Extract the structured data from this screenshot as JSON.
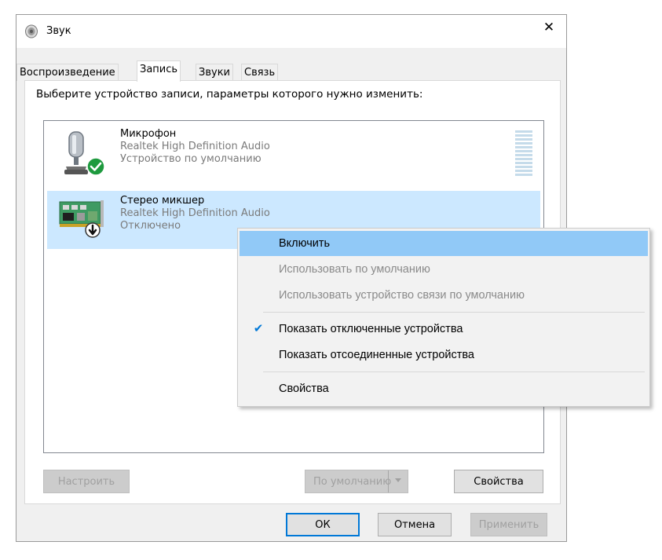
{
  "window": {
    "title": "Звук",
    "close_glyph": "✕"
  },
  "tabs": [
    {
      "label": "Воспроизведение",
      "active": false
    },
    {
      "label": "Запись",
      "active": true
    },
    {
      "label": "Звуки",
      "active": false
    },
    {
      "label": "Связь",
      "active": false
    }
  ],
  "recording": {
    "instruction": "Выберите устройство записи, параметры которого нужно изменить:",
    "devices": [
      {
        "name": "Микрофон",
        "driver": "Realtek High Definition Audio",
        "status": "Устройство по умолчанию",
        "icon": "microphone-icon",
        "badge": "default-check-icon",
        "selected": false
      },
      {
        "name": "Стерео микшер",
        "driver": "Realtek High Definition Audio",
        "status": "Отключено",
        "icon": "sound-card-icon",
        "badge": "disabled-arrow-icon",
        "selected": true
      }
    ]
  },
  "buttons": {
    "configure": "Настроить",
    "set_default": "По умолчанию",
    "properties": "Свойства",
    "ok": "ОК",
    "cancel": "Отмена",
    "apply": "Применить"
  },
  "context_menu": {
    "items": [
      {
        "label": "Включить",
        "state": "hover"
      },
      {
        "label": "Использовать по умолчанию",
        "state": "disabled"
      },
      {
        "label": "Использовать устройство связи по умолчанию",
        "state": "disabled"
      },
      {
        "label": "Показать отключенные устройства",
        "state": "checked"
      },
      {
        "label": "Показать отсоединенные устройства",
        "state": "normal"
      },
      {
        "label": "Свойства",
        "state": "normal"
      }
    ],
    "check_glyph": "✔"
  },
  "colors": {
    "selection": "#cce8ff",
    "menu_hover": "#91c9f7",
    "accent": "#0078d7",
    "check_badge": "#1e9a3e"
  }
}
